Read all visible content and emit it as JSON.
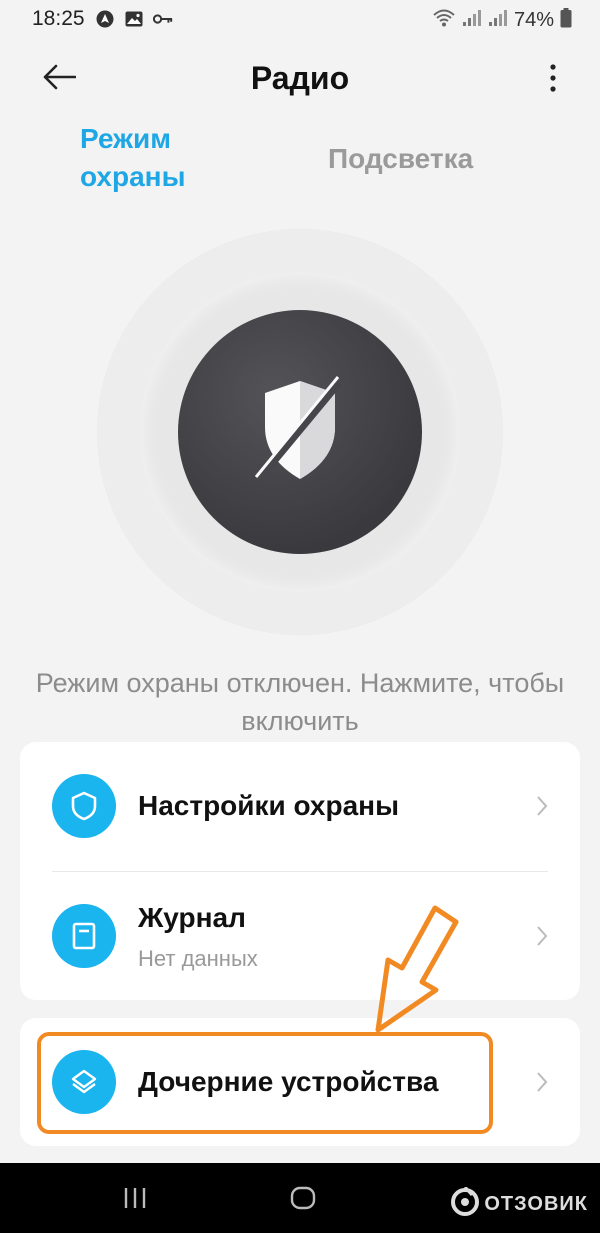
{
  "status_bar": {
    "time": "18:25",
    "battery_percent": "74%",
    "icons": [
      "navigation-icon",
      "image-icon",
      "key-icon",
      "wifi-icon",
      "signal-icon",
      "signal-icon",
      "battery-icon"
    ]
  },
  "header": {
    "title": "Радио",
    "back_icon": "arrow-left-icon",
    "menu_icon": "more-vertical-icon"
  },
  "tabs": [
    {
      "label": "Режим охраны",
      "active": true
    },
    {
      "label": "Подсветка",
      "active": false
    }
  ],
  "security_toggle": {
    "icon": "shield-off-icon",
    "armed": false
  },
  "hint_text": "Режим охраны отключен. Нажмите, чтобы включить",
  "menu": {
    "security_settings": {
      "title": "Настройки охраны",
      "icon": "shield-icon"
    },
    "journal": {
      "title": "Журнал",
      "subtitle": "Нет данных",
      "icon": "journal-icon"
    },
    "child_devices": {
      "title": "Дочерние устройства",
      "icon": "layers-icon"
    }
  },
  "navbar": {
    "recent_icon": "recent-apps-icon",
    "home_icon": "home-icon"
  },
  "watermark": {
    "text": "ОТЗОВИК"
  },
  "colors": {
    "accent": "#1ea7e4",
    "icon_circle": "#1ab4ee",
    "toggle": "#3b3b3f",
    "highlight": "#f28a24"
  }
}
